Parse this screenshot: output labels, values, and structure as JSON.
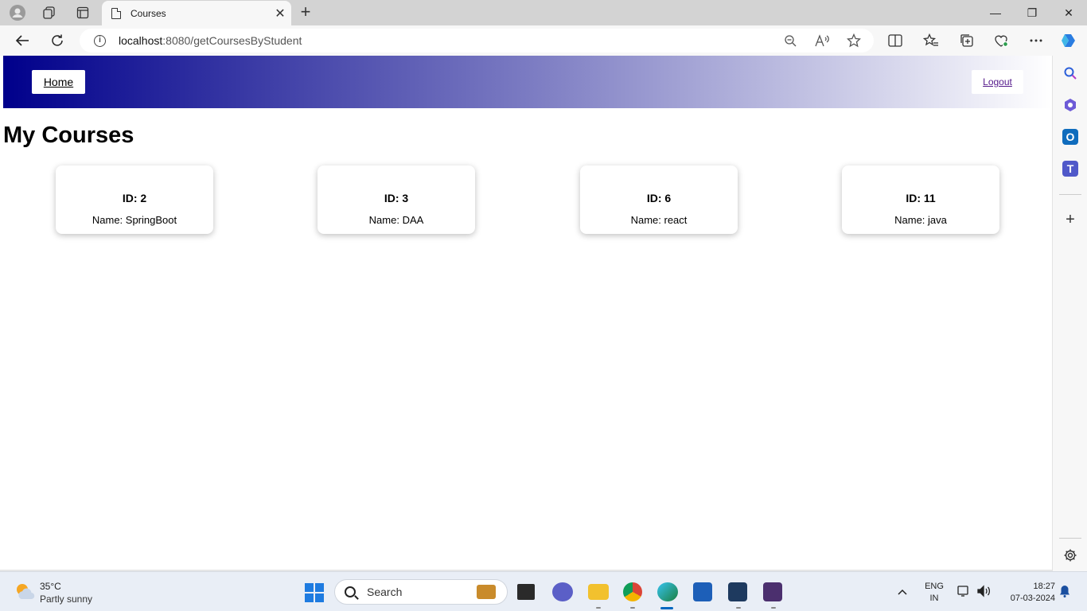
{
  "browser": {
    "tab_title": "Courses",
    "tab_close": "✕",
    "new_tab": "+",
    "url_host": "localhost",
    "url_rest": ":8080/getCoursesByStudent",
    "window_minimize": "—",
    "window_restore": "❐",
    "window_close": "✕"
  },
  "nav": {
    "home_label": "Home",
    "logout_label": "Logout"
  },
  "page": {
    "title": "My Courses"
  },
  "courses": [
    {
      "id_label": "ID: 2",
      "name_label": "Name: SpringBoot"
    },
    {
      "id_label": "ID: 3",
      "name_label": "Name: DAA"
    },
    {
      "id_label": "ID: 6",
      "name_label": "Name: react"
    },
    {
      "id_label": "ID: 11",
      "name_label": "Name: java"
    }
  ],
  "taskbar": {
    "weather_temp": "35°C",
    "weather_desc": "Partly sunny",
    "search_placeholder": "Search",
    "lang_line1": "ENG",
    "lang_line2": "IN",
    "time": "18:27",
    "date": "07-03-2024"
  },
  "colors": {
    "navbar_start": "#00008b",
    "navbar_end": "#ffffff",
    "logout_link": "#551a8b",
    "windows_blue": "#1e7be0"
  }
}
